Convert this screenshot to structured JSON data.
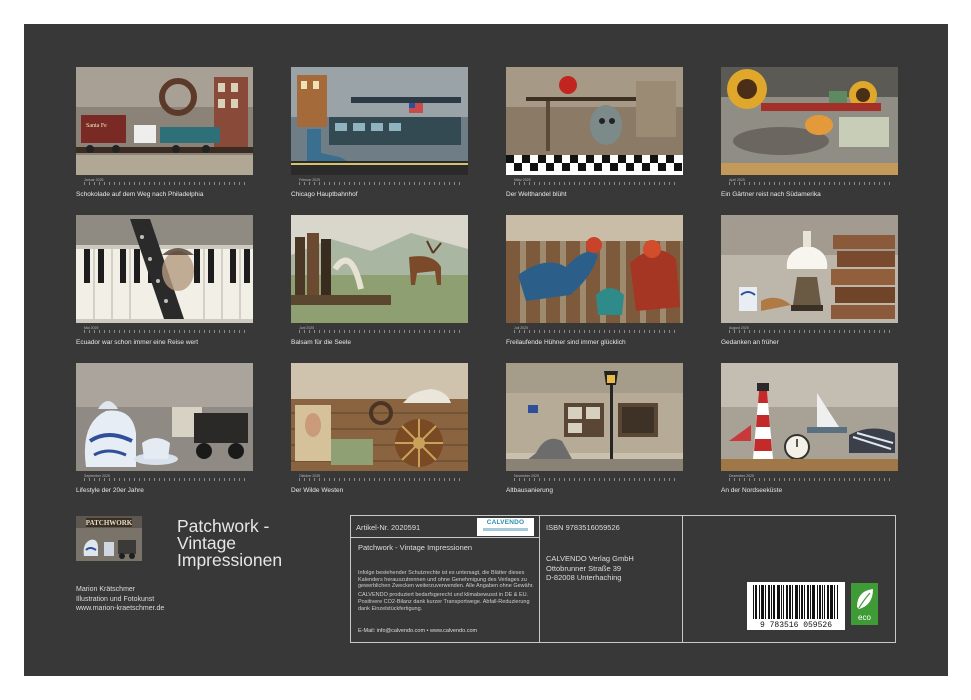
{
  "months": [
    {
      "label": "Januar 2025",
      "caption": "Schokolade auf dem Weg nach Philadelphia",
      "scene": "train"
    },
    {
      "label": "Februar 2025",
      "caption": "Chicago Hauptbahnhof",
      "scene": "station"
    },
    {
      "label": "März 2025",
      "caption": "Der Welthandel blüht",
      "scene": "scale"
    },
    {
      "label": "April 2025",
      "caption": "Ein Gärtner reist nach Südamerika",
      "scene": "sunflower"
    },
    {
      "label": "Mai 2025",
      "caption": "Ecuador war schon immer eine Reise wert",
      "scene": "piano"
    },
    {
      "label": "Juni 2025",
      "caption": "Balsam für die Seele",
      "scene": "books"
    },
    {
      "label": "Juli 2025",
      "caption": "Freilaufende Hühner sind immer glücklich",
      "scene": "roosters"
    },
    {
      "label": "August 2025",
      "caption": "Gedanken an früher",
      "scene": "lamp"
    },
    {
      "label": "September 2025",
      "caption": "Lifestyle der 20er Jahre",
      "scene": "teapot"
    },
    {
      "label": "Oktober 2025",
      "caption": "Der Wilde Westen",
      "scene": "western"
    },
    {
      "label": "November 2025",
      "caption": "Altbausanierung",
      "scene": "streetlamp"
    },
    {
      "label": "Dezember 2025",
      "caption": "An der Nordseeküste",
      "scene": "lighthouse"
    }
  ],
  "cover": {
    "thumb_text": "PATCHWORK",
    "title_lines": [
      "Patchwork -",
      "Vintage",
      "Impressionen"
    ]
  },
  "author": {
    "name": "Marion Krätschmer",
    "profession": "Illustration und Fotokunst",
    "website": "www.marion-kraetschmer.de"
  },
  "publisher": {
    "article_no": "Artikel-Nr. 2020591",
    "logo_text": "CALVENDO",
    "isbn": "ISBN 9783516059526",
    "product_title": "Patchwork - Vintage Impressionen",
    "company": "CALVENDO Verlag GmbH",
    "street": "Ottobrunner Straße 39",
    "city": "D-82008 Unterhaching",
    "legal_1": "Infolge bestehender Schutzrechte ist es untersagt, die Blätter dieses Kalenders herauszutrennen und ohne Genehmigung des Verlages zu gewerblichen Zwecken weiterzuverwenden. Alle Angaben ohne Gewähr.",
    "legal_2": "CALVENDO produziert bedarfsgerecht und klimabewusst in DE & EU. Positivere CO2-Bilanz dank kurzer Transportwege. Abfall-Reduzierung dank Einzelstückfertigung.",
    "contact": "E-Mail: info@calvendo.com • www.calvendo.com",
    "barcode_digits": "9 783516 059526",
    "eco_label": "eco"
  },
  "colors": {
    "background": "#383838",
    "text": "#e6e6e6",
    "calvendo_blue": "#2b8fb3",
    "eco_green": "#3f9b35"
  }
}
